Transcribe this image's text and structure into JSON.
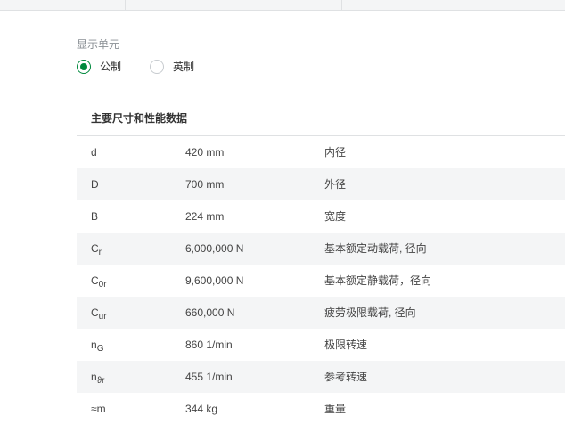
{
  "units": {
    "label": "显示单元",
    "options": [
      {
        "label": "公制",
        "selected": true
      },
      {
        "label": "英制",
        "selected": false
      }
    ]
  },
  "section": {
    "title": "主要尺寸和性能数据"
  },
  "rows": [
    {
      "sym": "d",
      "sub": "",
      "value": "420 mm",
      "desc": "内径"
    },
    {
      "sym": "D",
      "sub": "",
      "value": "700 mm",
      "desc": "外径"
    },
    {
      "sym": "B",
      "sub": "",
      "value": "224 mm",
      "desc": "宽度"
    },
    {
      "sym": "C",
      "sub": "r",
      "value": "6,000,000 N",
      "desc": "基本额定动载荷, 径向"
    },
    {
      "sym": "C",
      "sub": "0r",
      "value": "9,600,000 N",
      "desc": "基本额定静载荷，径向"
    },
    {
      "sym": "C",
      "sub": "ur",
      "value": "660,000 N",
      "desc": "疲劳极限载荷, 径向"
    },
    {
      "sym": "n",
      "sub": "G",
      "value": "860 1/min",
      "desc": "极限转速"
    },
    {
      "sym": "n",
      "sub": "ϑr",
      "value": "455 1/min",
      "desc": "参考转速"
    },
    {
      "sym": "≈m",
      "sub": "",
      "value": "344 kg",
      "desc": "重量"
    }
  ],
  "colors": {
    "accent": "#00893d",
    "row_alt": "#f4f5f6",
    "border": "#dfe1e3"
  }
}
